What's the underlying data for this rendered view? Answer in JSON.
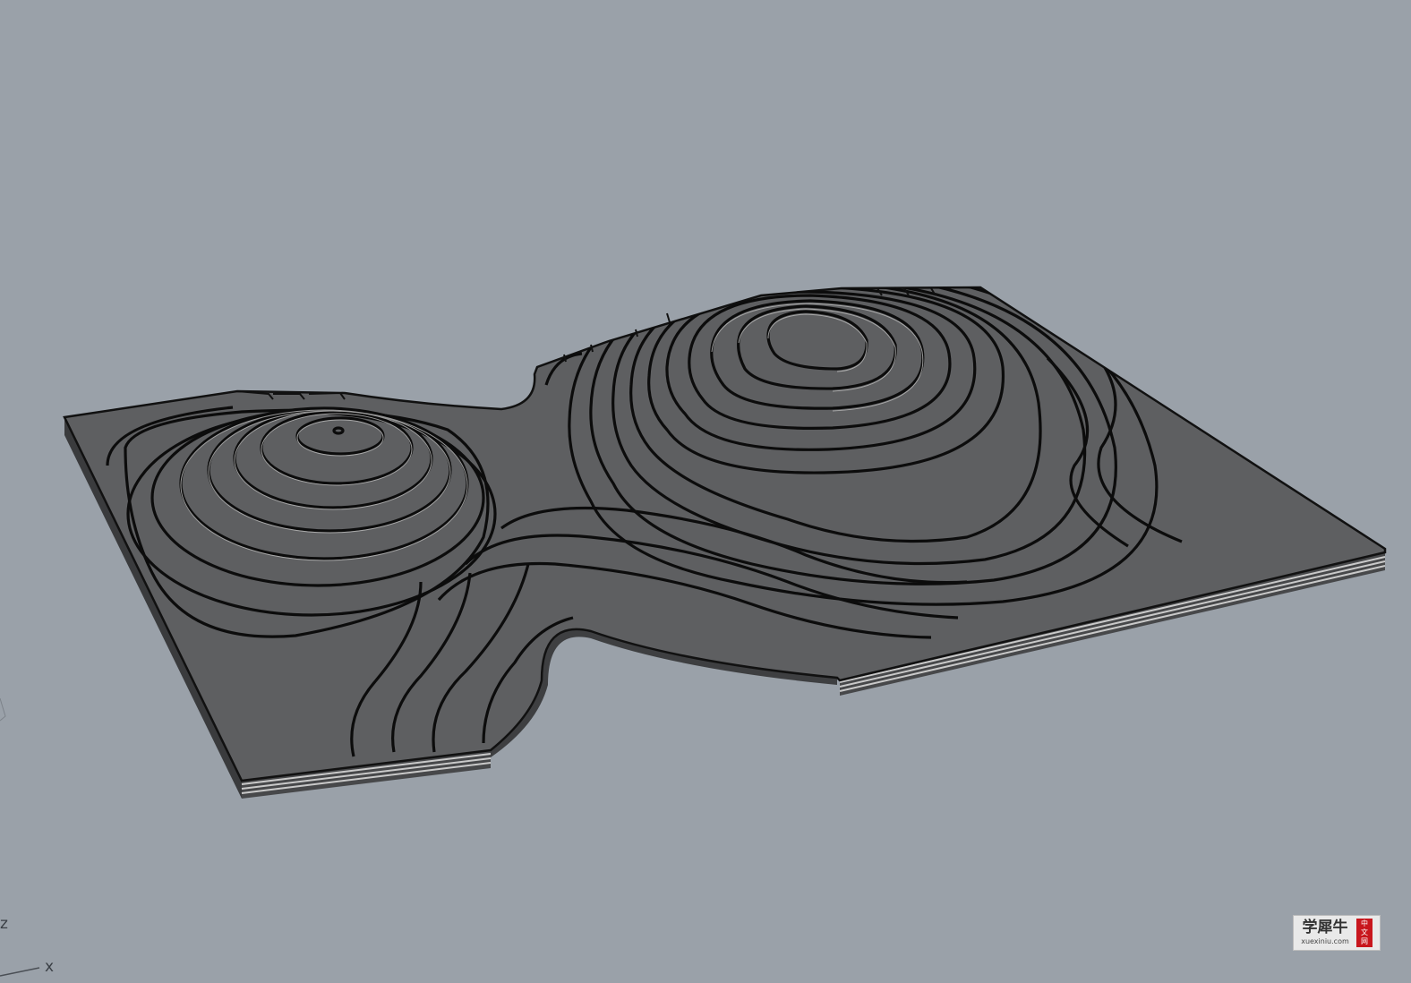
{
  "viewport": {
    "background": "#9aa1a9",
    "render_mode": "shaded-dark-gray",
    "axes": {
      "x_label": "x",
      "z_label": "z"
    }
  },
  "model": {
    "type": "topographic contour model",
    "color": "#5e5f61",
    "peaks": 2
  },
  "watermark": {
    "text_cn": "学犀牛",
    "url": "xuexiniu.com",
    "seal": [
      "中",
      "文",
      "网"
    ]
  }
}
